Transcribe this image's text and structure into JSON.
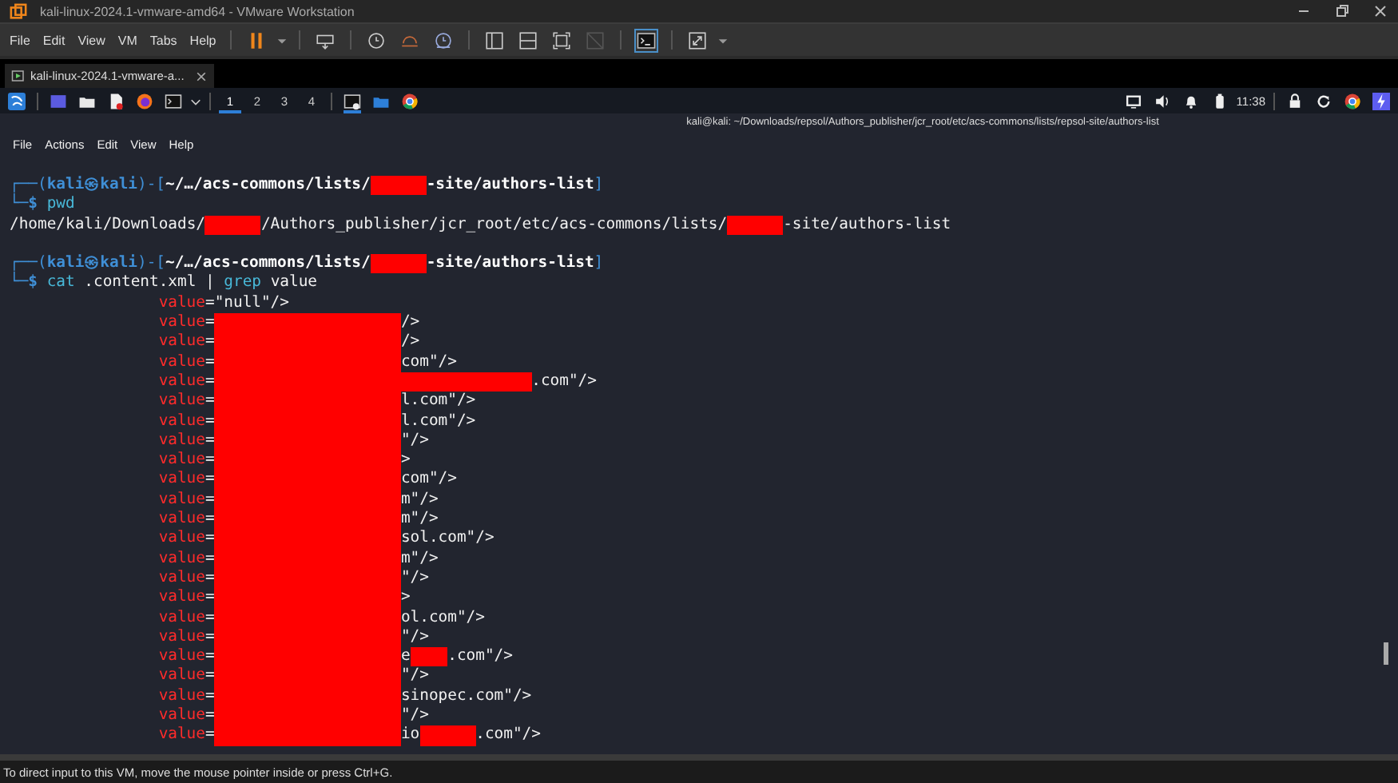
{
  "window": {
    "title": "kali-linux-2024.1-vmware-amd64 - VMware Workstation"
  },
  "menu": [
    "File",
    "Edit",
    "View",
    "VM",
    "Tabs",
    "Help"
  ],
  "vm_tab": {
    "label": "kali-linux-2024.1-vmware-a...",
    "selected": true
  },
  "panel": {
    "workspaces": [
      {
        "label": "1",
        "selected": true
      },
      {
        "label": "2",
        "selected": false
      },
      {
        "label": "3",
        "selected": false
      },
      {
        "label": "4",
        "selected": false
      }
    ],
    "clock": "11:38"
  },
  "terminal": {
    "title": "kali@kali: ~/Downloads/repsol/Authors_publisher/jcr_root/etc/acs-commons/lists/repsol-site/authors-list",
    "menu": [
      "File",
      "Actions",
      "Edit",
      "View",
      "Help"
    ],
    "lines": [
      {
        "kind": "prompt",
        "parts": [
          {
            "kind": "frame",
            "text": "┌──("
          },
          {
            "kind": "user",
            "text": "kali㉿kali"
          },
          {
            "kind": "frame",
            "text": ")-["
          },
          {
            "kind": "path",
            "text": "~/…/acs-commons/lists/"
          },
          {
            "kind": "redacted_medium"
          },
          {
            "kind": "path",
            "text": "-site/authors-list"
          },
          {
            "kind": "frame",
            "text": "]"
          }
        ]
      },
      {
        "kind": "command",
        "parts": [
          {
            "kind": "frame",
            "text": "└─"
          },
          {
            "kind": "dollar",
            "text": "$"
          },
          {
            "kind": "cmd",
            "text": "pwd"
          }
        ]
      },
      {
        "kind": "output",
        "parts": [
          {
            "kind": "text",
            "text": "/home/kali/Downloads/"
          },
          {
            "kind": "redacted_medium"
          },
          {
            "kind": "text",
            "text": "/Authors_publisher/jcr_root/etc/acs-commons/lists/"
          },
          {
            "kind": "redacted_medium"
          },
          {
            "kind": "text",
            "text": "-site/authors-list"
          }
        ]
      },
      {
        "kind": "blank"
      },
      {
        "kind": "prompt",
        "parts": [
          {
            "kind": "frame",
            "text": "┌──("
          },
          {
            "kind": "user",
            "text": "kali㉿kali"
          },
          {
            "kind": "frame",
            "text": ")-["
          },
          {
            "kind": "path",
            "text": "~/…/acs-commons/lists/"
          },
          {
            "kind": "redacted_medium"
          },
          {
            "kind": "path",
            "text": "-site/authors-list"
          },
          {
            "kind": "frame",
            "text": "]"
          }
        ]
      },
      {
        "kind": "command",
        "parts": [
          {
            "kind": "frame",
            "text": "└─"
          },
          {
            "kind": "dollar",
            "text": "$"
          },
          {
            "kind": "cmd",
            "text": "cat"
          },
          {
            "kind": "arg",
            "text": ".content.xml"
          },
          {
            "kind": "arg",
            "text": "|"
          },
          {
            "kind": "cmd",
            "text": "grep"
          },
          {
            "kind": "arg",
            "text": "value"
          }
        ]
      },
      {
        "kind": "value",
        "parts": [
          {
            "kind": "key",
            "text": "value"
          },
          {
            "kind": "text",
            "text": "=\"null\"/>"
          }
        ]
      },
      {
        "kind": "value",
        "parts": [
          {
            "kind": "key",
            "text": "value"
          },
          {
            "kind": "text",
            "text": "="
          },
          {
            "kind": "redacted_block"
          },
          {
            "kind": "text",
            "text": "/>"
          }
        ]
      },
      {
        "kind": "value",
        "parts": [
          {
            "kind": "key",
            "text": "value"
          },
          {
            "kind": "text",
            "text": "="
          },
          {
            "kind": "redacted_block"
          },
          {
            "kind": "text",
            "text": "/>"
          }
        ]
      },
      {
        "kind": "value",
        "parts": [
          {
            "kind": "key",
            "text": "value"
          },
          {
            "kind": "text",
            "text": "="
          },
          {
            "kind": "redacted_block"
          },
          {
            "kind": "text",
            "text": "com\"/>"
          }
        ]
      },
      {
        "kind": "value",
        "parts": [
          {
            "kind": "key",
            "text": "value"
          },
          {
            "kind": "text",
            "text": "="
          },
          {
            "kind": "redacted_block"
          },
          {
            "kind": "redacted_long"
          },
          {
            "kind": "text",
            "text": ".com\"/>"
          }
        ]
      },
      {
        "kind": "value",
        "parts": [
          {
            "kind": "key",
            "text": "value"
          },
          {
            "kind": "text",
            "text": "="
          },
          {
            "kind": "redacted_block"
          },
          {
            "kind": "text",
            "text": "l.com\"/>"
          }
        ]
      },
      {
        "kind": "value",
        "parts": [
          {
            "kind": "key",
            "text": "value"
          },
          {
            "kind": "text",
            "text": "="
          },
          {
            "kind": "redacted_block"
          },
          {
            "kind": "text",
            "text": "l.com\"/>"
          }
        ]
      },
      {
        "kind": "value",
        "parts": [
          {
            "kind": "key",
            "text": "value"
          },
          {
            "kind": "text",
            "text": "="
          },
          {
            "kind": "redacted_block"
          },
          {
            "kind": "text",
            "text": "\"/>"
          }
        ]
      },
      {
        "kind": "value",
        "parts": [
          {
            "kind": "key",
            "text": "value"
          },
          {
            "kind": "text",
            "text": "="
          },
          {
            "kind": "redacted_block"
          },
          {
            "kind": "text",
            "text": ">"
          }
        ]
      },
      {
        "kind": "value",
        "parts": [
          {
            "kind": "key",
            "text": "value"
          },
          {
            "kind": "text",
            "text": "="
          },
          {
            "kind": "redacted_block"
          },
          {
            "kind": "text",
            "text": "com\"/>"
          }
        ]
      },
      {
        "kind": "value",
        "parts": [
          {
            "kind": "key",
            "text": "value"
          },
          {
            "kind": "text",
            "text": "="
          },
          {
            "kind": "redacted_block"
          },
          {
            "kind": "text",
            "text": "m\"/>"
          }
        ]
      },
      {
        "kind": "value",
        "parts": [
          {
            "kind": "key",
            "text": "value"
          },
          {
            "kind": "text",
            "text": "="
          },
          {
            "kind": "redacted_block"
          },
          {
            "kind": "text",
            "text": "m\"/>"
          }
        ]
      },
      {
        "kind": "value",
        "parts": [
          {
            "kind": "key",
            "text": "value"
          },
          {
            "kind": "text",
            "text": "="
          },
          {
            "kind": "redacted_block"
          },
          {
            "kind": "text",
            "text": "sol.com\"/>"
          }
        ]
      },
      {
        "kind": "value",
        "parts": [
          {
            "kind": "key",
            "text": "value"
          },
          {
            "kind": "text",
            "text": "="
          },
          {
            "kind": "redacted_block"
          },
          {
            "kind": "text",
            "text": "m\"/>"
          }
        ]
      },
      {
        "kind": "value",
        "parts": [
          {
            "kind": "key",
            "text": "value"
          },
          {
            "kind": "text",
            "text": "="
          },
          {
            "kind": "redacted_block"
          },
          {
            "kind": "text",
            "text": "\"/>"
          }
        ]
      },
      {
        "kind": "value",
        "parts": [
          {
            "kind": "key",
            "text": "value"
          },
          {
            "kind": "text",
            "text": "="
          },
          {
            "kind": "redacted_block"
          },
          {
            "kind": "text",
            "text": ">"
          }
        ]
      },
      {
        "kind": "value",
        "parts": [
          {
            "kind": "key",
            "text": "value"
          },
          {
            "kind": "text",
            "text": "="
          },
          {
            "kind": "redacted_block"
          },
          {
            "kind": "text",
            "text": "ol.com\"/>"
          }
        ]
      },
      {
        "kind": "value",
        "parts": [
          {
            "kind": "key",
            "text": "value"
          },
          {
            "kind": "text",
            "text": "="
          },
          {
            "kind": "redacted_block"
          },
          {
            "kind": "text",
            "text": "\"/>"
          }
        ]
      },
      {
        "kind": "value",
        "parts": [
          {
            "kind": "key",
            "text": "value"
          },
          {
            "kind": "text",
            "text": "="
          },
          {
            "kind": "redacted_block"
          },
          {
            "kind": "text",
            "text": "e"
          },
          {
            "kind": "redacted_short"
          },
          {
            "kind": "text",
            "text": ".com\"/>"
          }
        ]
      },
      {
        "kind": "value",
        "parts": [
          {
            "kind": "key",
            "text": "value"
          },
          {
            "kind": "text",
            "text": "="
          },
          {
            "kind": "redacted_block"
          },
          {
            "kind": "text",
            "text": "\"/>"
          }
        ]
      },
      {
        "kind": "value",
        "parts": [
          {
            "kind": "key",
            "text": "value"
          },
          {
            "kind": "text",
            "text": "="
          },
          {
            "kind": "redacted_block"
          },
          {
            "kind": "text",
            "text": "sinopec.com\"/>"
          }
        ]
      },
      {
        "kind": "value",
        "parts": [
          {
            "kind": "key",
            "text": "value"
          },
          {
            "kind": "text",
            "text": "="
          },
          {
            "kind": "redacted_block"
          },
          {
            "kind": "text",
            "text": "\"/>"
          }
        ]
      },
      {
        "kind": "value",
        "parts": [
          {
            "kind": "key",
            "text": "value"
          },
          {
            "kind": "text",
            "text": "="
          },
          {
            "kind": "redacted_block"
          },
          {
            "kind": "text",
            "text": "io"
          },
          {
            "kind": "redacted_medium"
          },
          {
            "kind": "text",
            "text": ".com\"/>"
          }
        ]
      }
    ]
  },
  "status_bar": "To direct input to this VM, move the mouse pointer inside or press Ctrl+G."
}
